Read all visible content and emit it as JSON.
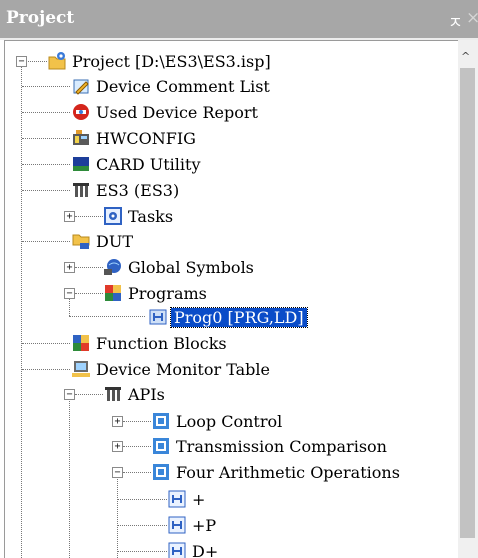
{
  "panel": {
    "title": "Project",
    "pin_glyph": "ㅈ",
    "close_glyph": "×"
  },
  "tree": {
    "root": {
      "label": "Project [D:\\ES3\\ES3.isp]",
      "icon": "project-icon"
    },
    "items": [
      {
        "label": "Device Comment List",
        "icon": "device-comment-icon"
      },
      {
        "label": "Used Device Report",
        "icon": "used-device-report-icon"
      },
      {
        "label": "HWCONFIG",
        "icon": "hwconfig-icon"
      },
      {
        "label": "CARD Utility",
        "icon": "card-utility-icon"
      },
      {
        "label": "ES3  (ES3)",
        "icon": "plc-icon"
      },
      {
        "label": "Tasks",
        "icon": "tasks-icon"
      },
      {
        "label": "DUT",
        "icon": "dut-icon"
      },
      {
        "label": "Global Symbols",
        "icon": "global-symbols-icon"
      },
      {
        "label": "Programs",
        "icon": "programs-icon"
      },
      {
        "label": "Prog0 [PRG,LD]",
        "icon": "program-icon",
        "selected": true
      },
      {
        "label": "Function Blocks",
        "icon": "function-blocks-icon"
      },
      {
        "label": "Device Monitor Table",
        "icon": "device-monitor-icon"
      },
      {
        "label": "APIs",
        "icon": "apis-icon"
      },
      {
        "label": "Loop Control",
        "icon": "api-group-icon"
      },
      {
        "label": "Transmission Comparison",
        "icon": "api-group-icon"
      },
      {
        "label": "Four Arithmetic Operations",
        "icon": "api-group-icon"
      },
      {
        "label": "+",
        "icon": "api-instruction-icon"
      },
      {
        "label": "+P",
        "icon": "api-instruction-icon"
      },
      {
        "label": "D+",
        "icon": "api-instruction-icon"
      }
    ],
    "expanders": {
      "collapsed": "+",
      "expanded": "−"
    }
  },
  "colors": {
    "titlebar": "#a7a7a7",
    "selection": "#0a4cc8"
  }
}
